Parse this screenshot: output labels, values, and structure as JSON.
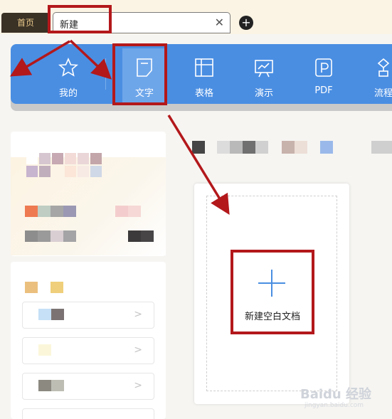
{
  "tabs": {
    "home": "首页",
    "new": "新建",
    "close": "✕",
    "add": "+"
  },
  "toolbar": {
    "items": [
      {
        "label": "我的",
        "icon": "star-icon"
      },
      {
        "label": "文字",
        "icon": "document-icon"
      },
      {
        "label": "表格",
        "icon": "table-icon"
      },
      {
        "label": "演示",
        "icon": "presentation-icon"
      },
      {
        "label": "PDF",
        "icon": "pdf-icon"
      },
      {
        "label": "流程",
        "icon": "flowchart-icon"
      }
    ],
    "active": "文字"
  },
  "main": {
    "new_blank_doc": "新建空白文档"
  },
  "watermark": {
    "text": "Baidu 经验",
    "sub": "jingyan.baidu.com"
  },
  "colors": {
    "toolbar": "#4a8ee2",
    "annotation": "#b3181b",
    "home_tab_bg": "#3b3226"
  }
}
